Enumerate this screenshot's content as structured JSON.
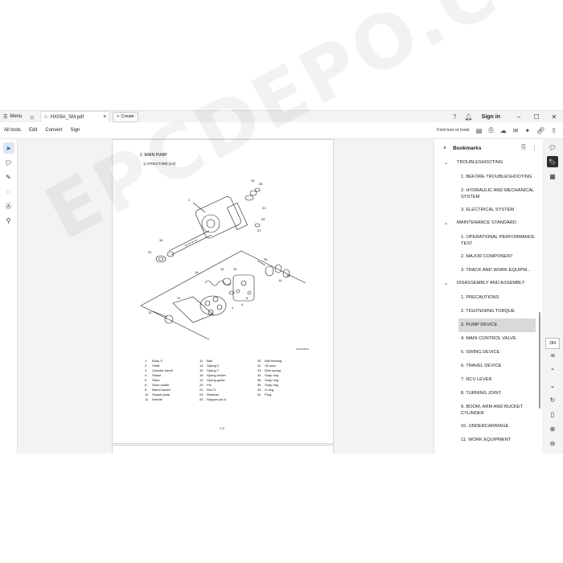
{
  "titlebar": {
    "menu_label": "Menu",
    "tab_title": "HX09A_SM.pdf",
    "create_label": "Create",
    "signin_label": "Sign in"
  },
  "menubar": {
    "items": [
      "All tools",
      "Edit",
      "Convert",
      "Sign"
    ],
    "find_label": "Find text or tools"
  },
  "document": {
    "title": "2. MAIN PUMP",
    "subtitle": "1) STRUCTURE (1/2)",
    "figure_code": "1500AMP01",
    "page_number": "7-9",
    "watermark": "EPCDEPO.COM",
    "parts_col1": [
      {
        "num": "1",
        "name": "Body S"
      },
      {
        "num": "2",
        "name": "Shaft"
      },
      {
        "num": "3",
        "name": "Cylinder barrel"
      },
      {
        "num": "4",
        "name": "Piston"
      },
      {
        "num": "5",
        "name": "Shoe"
      },
      {
        "num": "8",
        "name": "Shoe holder"
      },
      {
        "num": "9",
        "name": "Barrel holder"
      },
      {
        "num": "10",
        "name": "Swash plate"
      },
      {
        "num": "11",
        "name": "Needle"
      }
    ],
    "parts_col2": [
      {
        "num": "12",
        "name": "Ball"
      },
      {
        "num": "14",
        "name": "Spring C"
      },
      {
        "num": "15",
        "name": "Spring T"
      },
      {
        "num": "18",
        "name": "Spring holder"
      },
      {
        "num": "19",
        "name": "Spring guide"
      },
      {
        "num": "20",
        "name": "Pin"
      },
      {
        "num": "21",
        "name": "Rod G"
      },
      {
        "num": "24",
        "name": "Retainer"
      },
      {
        "num": "25",
        "name": "Stopper pin A"
      }
    ],
    "parts_col3": [
      {
        "num": "30",
        "name": "Ball bearing"
      },
      {
        "num": "32",
        "name": "Oil seal"
      },
      {
        "num": "33",
        "name": "Dish spring"
      },
      {
        "num": "34",
        "name": "Snap ring"
      },
      {
        "num": "35",
        "name": "Snap ring"
      },
      {
        "num": "36",
        "name": "Snap ring"
      },
      {
        "num": "39",
        "name": "O-ring"
      },
      {
        "num": "51",
        "name": "Plug"
      }
    ]
  },
  "bookmarks": {
    "title": "Bookmarks",
    "sections": [
      {
        "label": "TROUBLESHOOTING",
        "items": [
          "1. BEFORE TROUBLESHOOTING",
          "2. HYDRAULIC AND MECHANICAL SYSTEM",
          "3. ELECTRICAL SYSTEM"
        ]
      },
      {
        "label": "MAINTENANCE STANDARD",
        "items": [
          "1. OPERATIONAL PERFORMANCE TEST",
          "2. MAJOR COMPONENT",
          "3. TRACK AND WORK EQUIPM..."
        ]
      },
      {
        "label": "DISASSEMBLY AND ASSEMBLY",
        "items": [
          "1. PRECAUTIONS",
          "2. TIGHTENING TORQUE",
          "3. PUMP DEVICE",
          "4. MAIN CONTROL VALVE",
          "5. SWING DEVICE",
          "6. TRAVEL DEVICE",
          "7. RCV LEVER",
          "8. TURNING JOINT",
          "9. BOOM, ARM AND BUCKET CYLINDER",
          "10. UNDERCARRIAGE",
          "11. WORK EQUIPMENT"
        ]
      }
    ],
    "selected": "3. PUMP DEVICE"
  },
  "navigator": {
    "current_page": "284",
    "total_pages": "48"
  }
}
